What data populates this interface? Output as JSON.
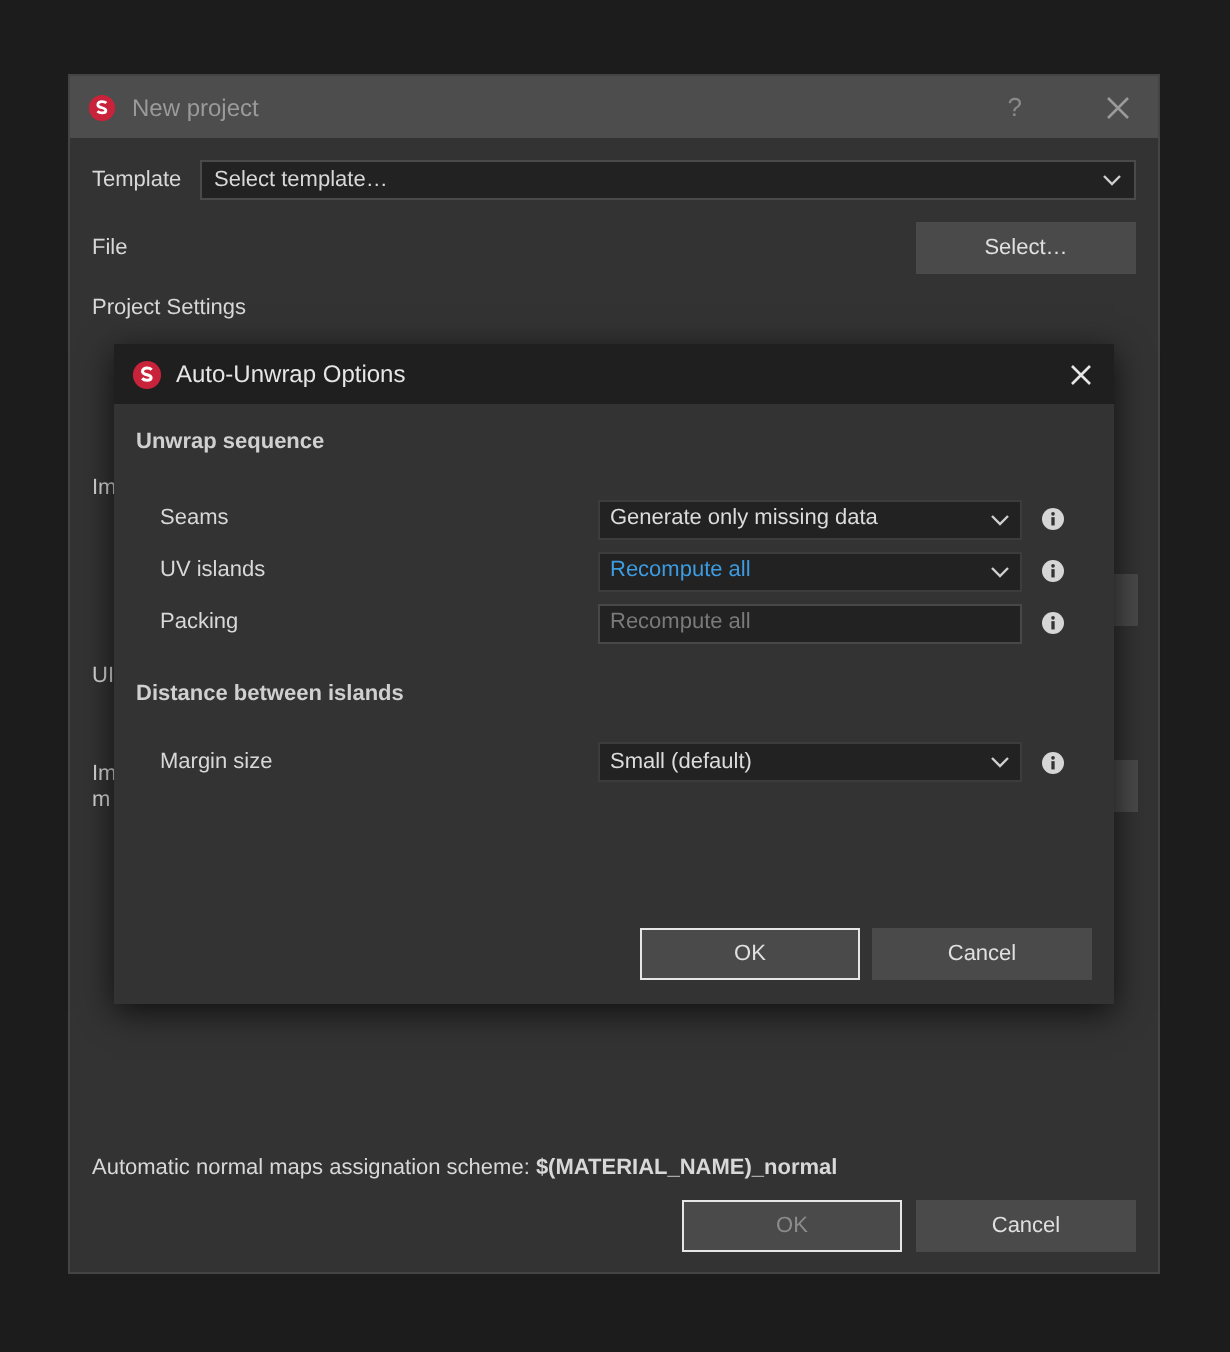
{
  "main_window": {
    "title": "New project",
    "help": "?",
    "template": {
      "label": "Template",
      "value": "Select template…"
    },
    "file": {
      "label": "File",
      "button": "Select…"
    },
    "section": "Project Settings",
    "obscured_labels": [
      "Im",
      "UI",
      "Im",
      "m"
    ],
    "normal_maps_scheme": "Automatic normal maps assignation scheme: **$(MATERIAL_NAME)_normal**",
    "buttons": [
      {
        "label": "OK",
        "disabled": true,
        "focused": true
      },
      {
        "label": "Cancel",
        "disabled": false,
        "focused": false
      }
    ]
  },
  "dialog": {
    "title": "Auto-Unwrap Options",
    "sections": [
      {
        "heading": "Unwrap sequence",
        "rows": [
          {
            "label": "Seams",
            "value": "Generate only missing data",
            "kind": "dropdown",
            "highlighted": false,
            "disabled": false
          },
          {
            "label": "UV islands",
            "value": "Recompute all",
            "kind": "dropdown",
            "highlighted": true,
            "disabled": false
          },
          {
            "label": "Packing",
            "value": "Recompute all",
            "kind": "dropdown",
            "highlighted": false,
            "disabled": true
          }
        ]
      },
      {
        "heading": "Distance between islands",
        "rows": [
          {
            "label": "Margin size",
            "value": "Small (default)",
            "kind": "dropdown",
            "highlighted": false,
            "disabled": false
          }
        ]
      }
    ],
    "buttons": [
      {
        "label": "OK",
        "disabled": false,
        "focused": true
      },
      {
        "label": "Cancel",
        "disabled": false,
        "focused": false
      }
    ]
  }
}
